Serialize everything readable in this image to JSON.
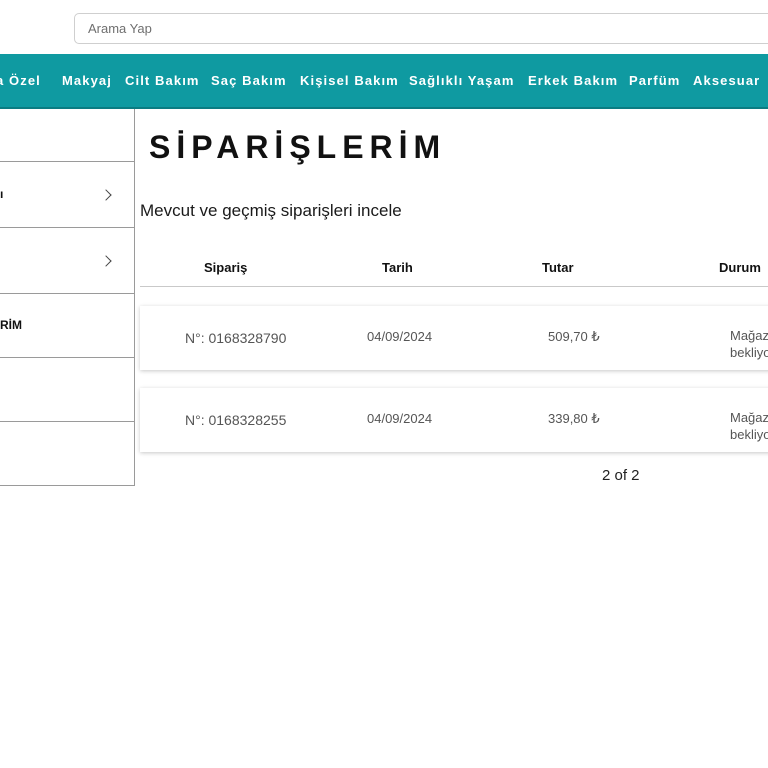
{
  "search": {
    "placeholder": "Arama Yap",
    "value": ""
  },
  "nav": {
    "items": [
      {
        "label": "a Özel"
      },
      {
        "label": "Makyaj"
      },
      {
        "label": "Cilt Bakım"
      },
      {
        "label": "Saç Bakım"
      },
      {
        "label": "Kişisel Bakım"
      },
      {
        "label": "Sağlıklı Yaşam"
      },
      {
        "label": "Erkek Bakım"
      },
      {
        "label": "Parfüm"
      },
      {
        "label": "Aksesuar"
      }
    ]
  },
  "sidebar": {
    "items": [
      {
        "label": ""
      },
      {
        "label": "ı"
      },
      {
        "label": ""
      },
      {
        "label": "RİM"
      },
      {
        "label": ""
      },
      {
        "label": ""
      }
    ]
  },
  "page": {
    "title": "SİPARİŞLERİM",
    "subtitle": "Mevcut ve geçmiş siparişleri incele"
  },
  "table": {
    "columns": [
      "Sipariş",
      "Tarih",
      "Tutar",
      "Durum"
    ],
    "orders": [
      {
        "number": "N°: 0168328790",
        "date": "04/09/2024",
        "amount": "509,70 ₺",
        "status": "Mağaz\nbekliyo"
      },
      {
        "number": "N°: 0168328255",
        "date": "04/09/2024",
        "amount": "339,80 ₺",
        "status": "Mağaz\nbekliyo"
      }
    ]
  },
  "pagination": {
    "label": "2 of 2"
  },
  "colors": {
    "nav_bg": "#0f9aa1",
    "nav_text": "#ffffff",
    "border": "#9a9a9a"
  }
}
